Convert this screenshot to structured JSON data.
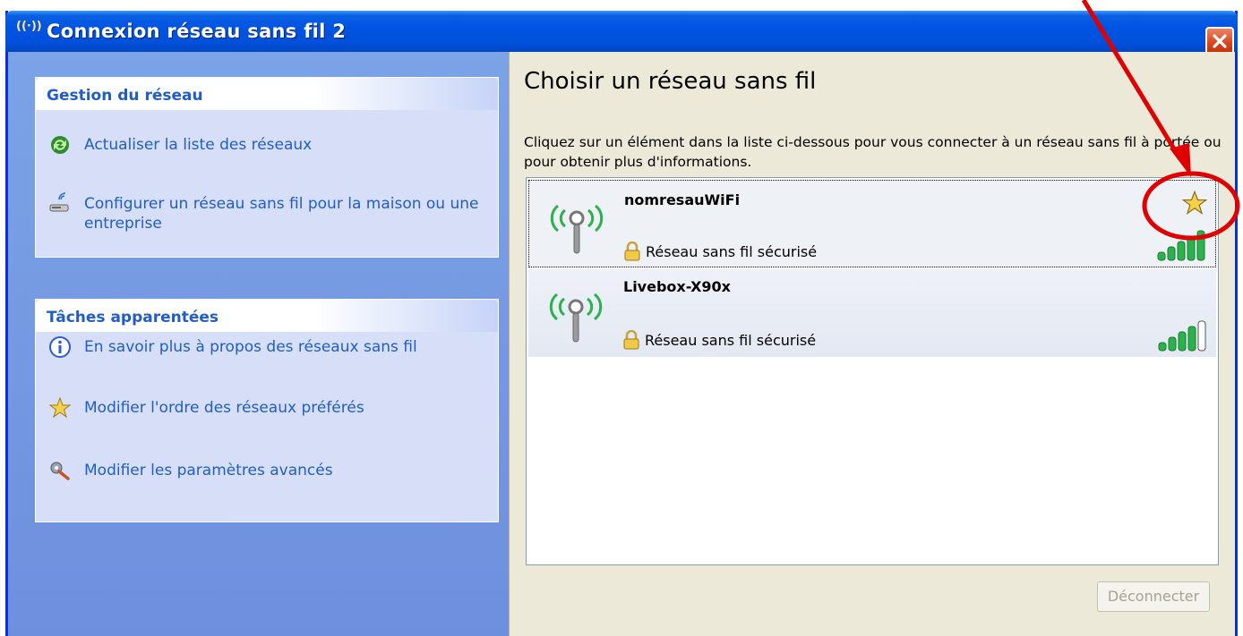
{
  "window": {
    "title": "Connexion réseau sans fil 2",
    "title_icon": "wireless-icon",
    "close_icon": "close-icon"
  },
  "left": {
    "network_panel": {
      "heading": "Gestion du réseau",
      "tasks": [
        {
          "label": "Actualiser la liste des réseaux",
          "icon": "refresh-icon"
        },
        {
          "label": "Configurer un réseau sans fil pour la maison ou une entreprise",
          "icon": "wireless-setup-icon"
        }
      ]
    },
    "related_panel": {
      "heading": "Tâches apparentées",
      "tasks": [
        {
          "label": "En savoir plus à propos des réseaux sans fil",
          "icon": "info-icon"
        },
        {
          "label": "Modifier l'ordre des réseaux préférés",
          "icon": "star-icon"
        },
        {
          "label": "Modifier les paramètres avancés",
          "icon": "settings-icon"
        }
      ]
    }
  },
  "main": {
    "heading": "Choisir un réseau sans fil",
    "instructions": "Cliquez sur un élément dans la liste ci-dessous pour vous connecter à un réseau sans fil à portée ou pour obtenir plus d'informations.",
    "networks": [
      {
        "name": "nomresauWiFi",
        "status": "Réseau sans fil sécurisé",
        "signal_bars": 5,
        "signal_max": 5,
        "preferred": true,
        "selected": true
      },
      {
        "name": "Livebox-X90x",
        "status": "Réseau sans fil sécurisé",
        "signal_bars": 4,
        "signal_max": 5,
        "preferred": false,
        "selected": false
      }
    ],
    "disconnect_label": "Déconnecter"
  },
  "colors": {
    "titlebar": "#0054e3",
    "task_link": "#215dc6",
    "annotation_red": "#e00000",
    "signal_green": "#2bb24c"
  }
}
